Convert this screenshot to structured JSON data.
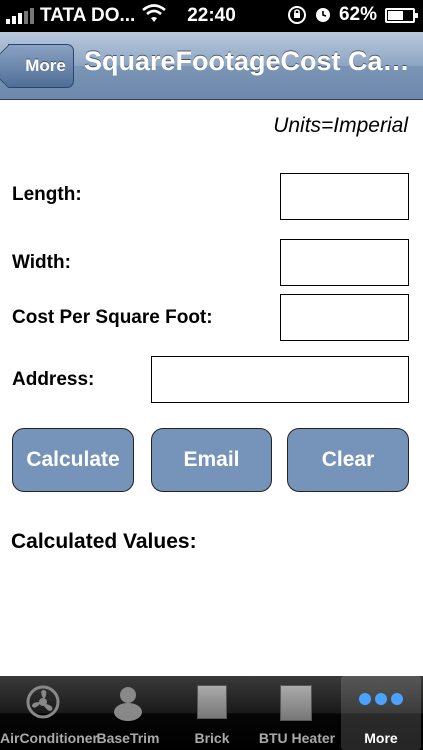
{
  "status": {
    "carrier": "TATA DO...",
    "time": "22:40",
    "battery": "62%",
    "battery_level": 0.62
  },
  "nav": {
    "back_label": "More",
    "title": "SquareFootageCost Calculator"
  },
  "form": {
    "units": "Units=Imperial",
    "length_label": "Length:",
    "width_label": "Width:",
    "cost_label": "Cost Per Square Foot:",
    "address_label": "Address:",
    "length_value": "",
    "width_value": "",
    "cost_value": "",
    "address_value": ""
  },
  "actions": {
    "calculate": "Calculate",
    "email": "Email",
    "clear": "Clear"
  },
  "results": {
    "heading": "Calculated Values:"
  },
  "tabs": [
    {
      "label": "AirConditioner",
      "icon": "fan-icon"
    },
    {
      "label": "BaseTrim",
      "icon": "person-icon"
    },
    {
      "label": "Brick",
      "icon": "square-icon"
    },
    {
      "label": "BTU Heater",
      "icon": "square-icon"
    },
    {
      "label": "More",
      "icon": "more-dots-icon",
      "selected": true
    }
  ],
  "colors": {
    "nav_bar": "#7b95b6",
    "button": "#7694b9",
    "tab_selected_dots": "#4aa3ff"
  }
}
